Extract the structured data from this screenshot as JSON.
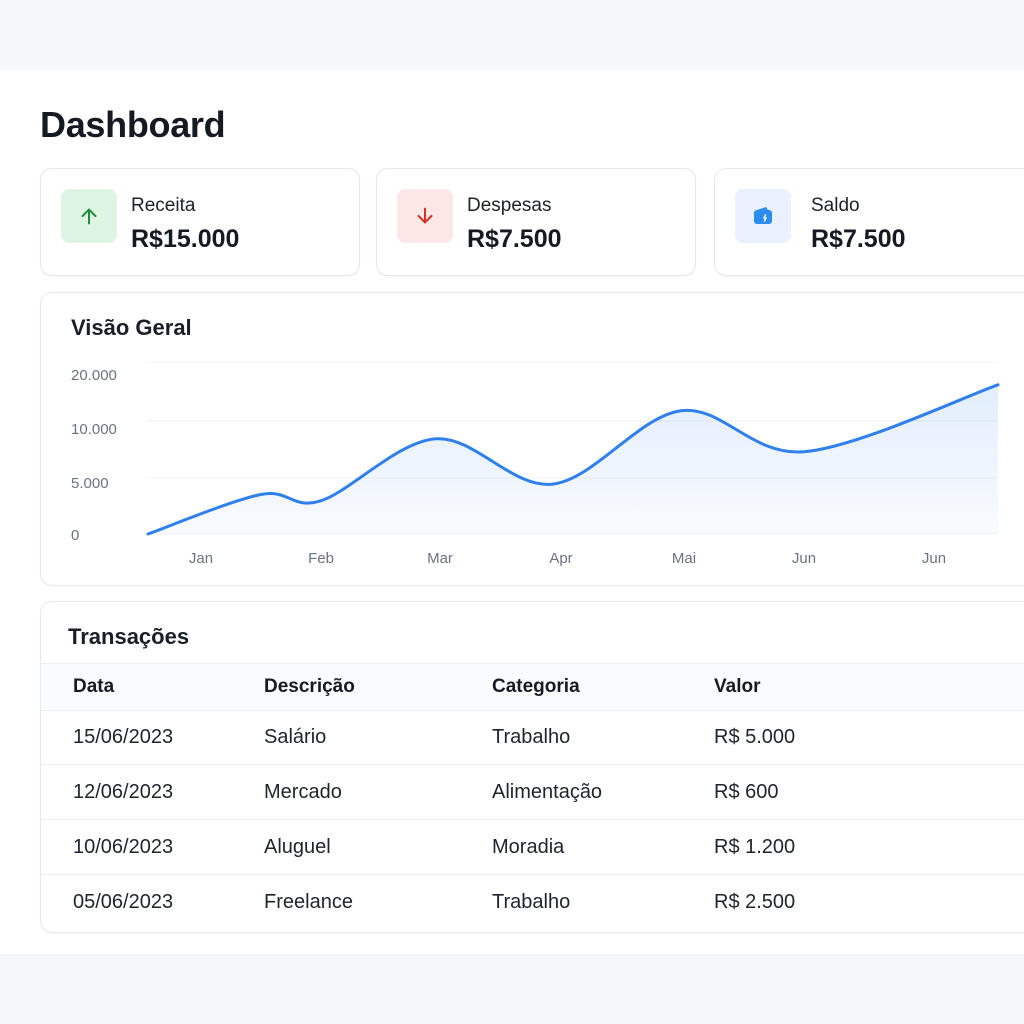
{
  "page": {
    "title": "Dashboard"
  },
  "stats": [
    {
      "label": "Receita",
      "value": "R$15.000",
      "icon": "arrow-up-icon",
      "icon_color": "#1e8e3e",
      "icon_bg": "#dff5e3"
    },
    {
      "label": "Despesas",
      "value": "R$7.500",
      "icon": "arrow-down-icon",
      "icon_color": "#d93025",
      "icon_bg": "#fde8e8"
    },
    {
      "label": "Saldo",
      "value": "R$7.500",
      "icon": "wallet-icon",
      "icon_color": "#2d8cf0",
      "icon_bg": "#e8f1fd"
    }
  ],
  "chart_section": {
    "title": "Visão Geral"
  },
  "chart_data": {
    "type": "area",
    "title": "Visão Geral",
    "categories": [
      "Jan",
      "Feb",
      "Mar",
      "Apr",
      "Mai",
      "Jun",
      "Jun"
    ],
    "y_tick_labels": [
      "20.000",
      "10.000",
      "5.000",
      "0"
    ],
    "series": [
      {
        "values": [
          3800,
          3200,
          9000,
          4800,
          13200,
          7800,
          18000
        ],
        "color": "#2f80ed"
      }
    ],
    "grid": true,
    "legend": "none"
  },
  "transactions": {
    "title": "Transações",
    "columns": [
      "Data",
      "Descrição",
      "Categoria",
      "Valor"
    ],
    "rows": [
      [
        "15/06/2023",
        "Salário",
        "Trabalho",
        "R$ 5.000"
      ],
      [
        "12/06/2023",
        "Mercado",
        "Alimentação",
        "R$ 600"
      ],
      [
        "10/06/2023",
        "Aluguel",
        "Moradia",
        "R$ 1.200"
      ],
      [
        "05/06/2023",
        "Freelance",
        "Trabalho",
        "R$ 2.500"
      ]
    ]
  }
}
